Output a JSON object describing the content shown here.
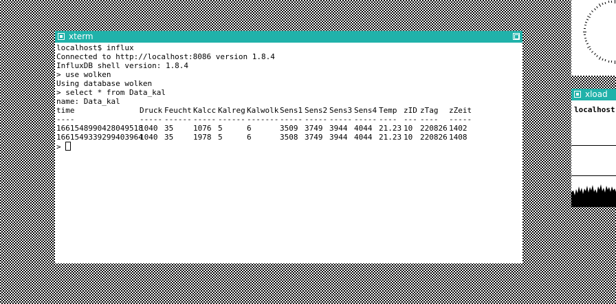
{
  "xterm": {
    "title": "xterm",
    "lines": [
      "localhost$ influx",
      "Connected to http://localhost:8086 version 1.8.4",
      "InfluxDB shell version: 1.8.4",
      "> use wolken",
      "Using database wolken",
      "> select * from Data_kal",
      "name: Data_kal"
    ],
    "headers": [
      "time",
      "Druck",
      "Feucht",
      "Kalcc",
      "Kalreg",
      "Kalwolk",
      "Sens1",
      "Sens2",
      "Sens3",
      "Sens4",
      "Temp",
      "zID",
      "zTag",
      "zZeit"
    ],
    "separators": [
      "----",
      "-----",
      "------",
      "-----",
      "------",
      "-------",
      "-----",
      "-----",
      "-----",
      "-----",
      "----",
      "---",
      "----",
      "-----"
    ],
    "rows": [
      [
        "1661548990428049518",
        "1040",
        "35",
        "1076",
        "5",
        "6",
        "3509",
        "3749",
        "3944",
        "4044",
        "21.23",
        "10",
        "220826",
        "1402"
      ],
      [
        "1661549339299403964",
        "1040",
        "35",
        "1978",
        "5",
        "6",
        "3508",
        "3749",
        "3944",
        "4044",
        "21.23",
        "10",
        "220826",
        "1408"
      ]
    ],
    "prompt": "> "
  },
  "xload": {
    "title": "xload",
    "host": "localhost"
  }
}
